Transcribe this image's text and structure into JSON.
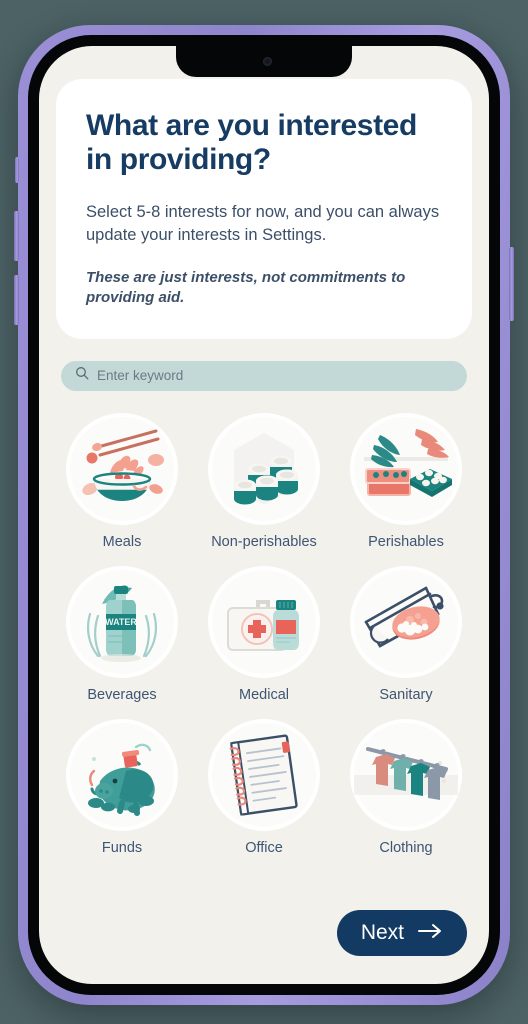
{
  "device": {
    "frame_color": "#9b8fd6",
    "bezel_color": "#050608",
    "page_background": "#4c6265"
  },
  "app": {
    "background": "#f2f1ec",
    "card_background": "#ffffff",
    "accent_navy": "#173c63",
    "accent_teal": "#2b8a87",
    "accent_coral": "#ef8274"
  },
  "hero": {
    "title": "What are you interested in providing?",
    "subtitle": "Select 5-8 interests for now, and you can always update your interests in Settings.",
    "note": "These are just interests, not commitments to providing aid."
  },
  "search": {
    "placeholder": "Enter keyword",
    "value": "",
    "icon": "search-icon",
    "background": "#c3d9d8"
  },
  "interests": [
    {
      "label": "Meals",
      "icon": "meals-bowl-icon"
    },
    {
      "label": "Non-perishables",
      "icon": "canned-goods-icon"
    },
    {
      "label": "Perishables",
      "icon": "produce-crate-icon"
    },
    {
      "label": "Beverages",
      "icon": "water-bottle-icon"
    },
    {
      "label": "Medical",
      "icon": "first-aid-kit-icon"
    },
    {
      "label": "Sanitary",
      "icon": "soap-bar-icon"
    },
    {
      "label": "Funds",
      "icon": "piggy-bank-icon"
    },
    {
      "label": "Office",
      "icon": "notepad-icon"
    },
    {
      "label": "Clothing",
      "icon": "clothing-rack-icon"
    }
  ],
  "footer": {
    "next_label": "Next",
    "next_icon": "arrow-right-icon",
    "next_background": "#123a63"
  }
}
